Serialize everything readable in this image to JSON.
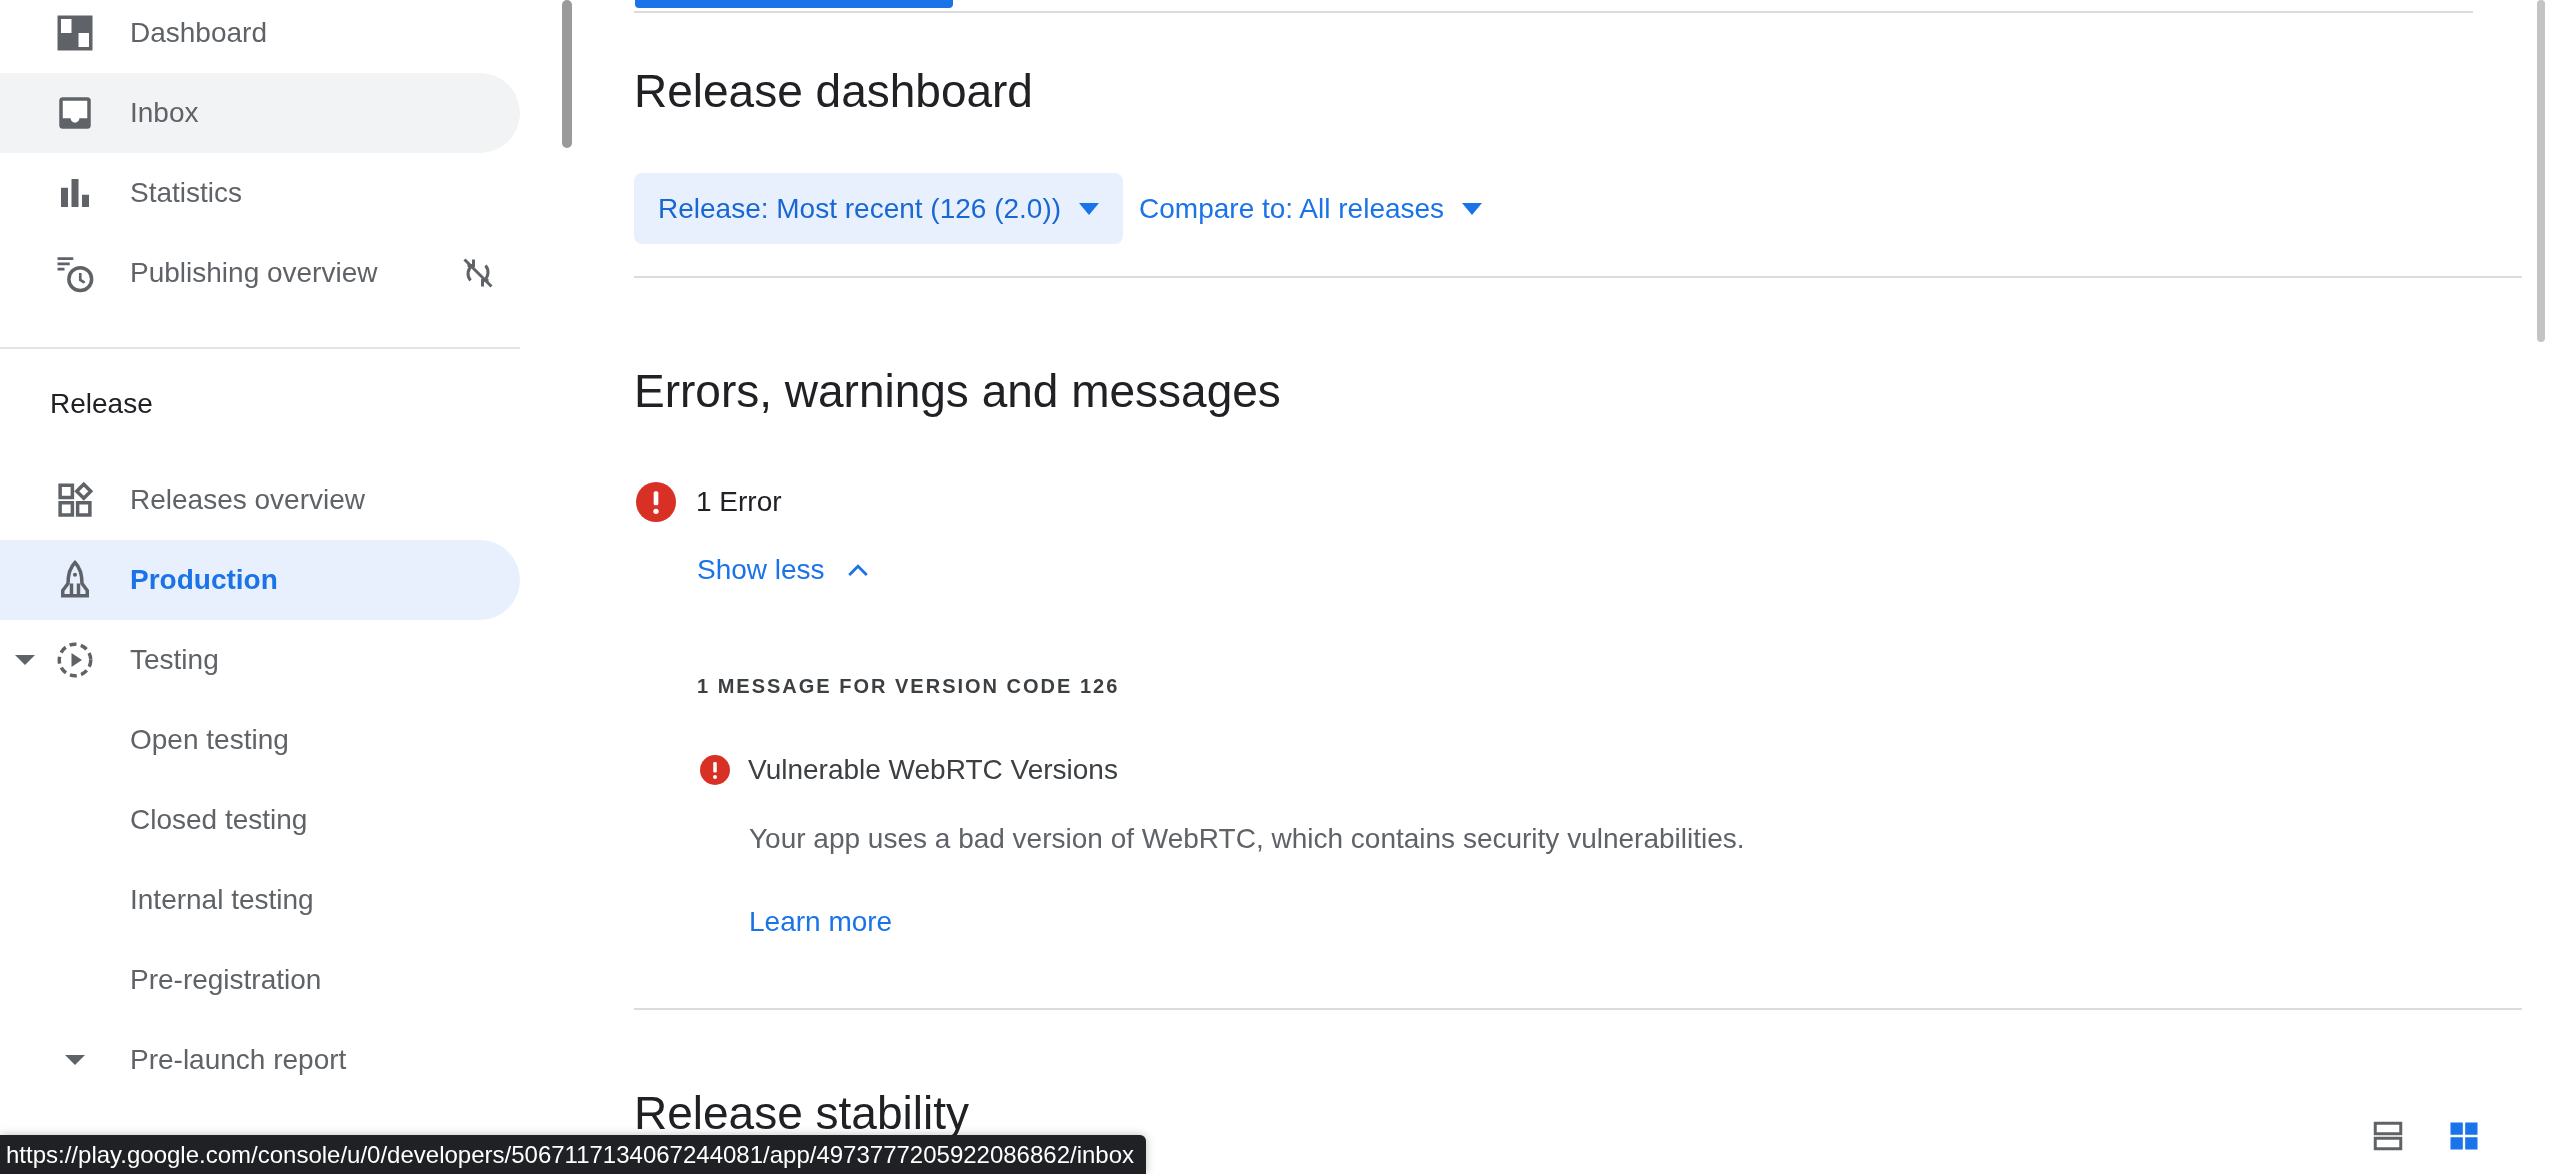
{
  "sidebar": {
    "top_items": [
      {
        "label": "Dashboard",
        "kind": "dashboard",
        "selected": false,
        "hovered": false,
        "sync_off": false
      },
      {
        "label": "Inbox",
        "kind": "inbox",
        "selected": false,
        "hovered": true,
        "sync_off": false
      },
      {
        "label": "Statistics",
        "kind": "statistics",
        "selected": false,
        "hovered": false,
        "sync_off": false
      },
      {
        "label": "Publishing overview",
        "kind": "publishing",
        "selected": false,
        "hovered": false,
        "sync_off": true
      }
    ],
    "section_title": "Release",
    "section_items": [
      {
        "label": "Releases overview",
        "kind": "releases",
        "selected": false
      },
      {
        "label": "Production",
        "kind": "production",
        "selected": true
      },
      {
        "label": "Testing",
        "kind": "testing",
        "selected": false,
        "expanded": true,
        "children": [
          {
            "label": "Open testing",
            "selected": false
          },
          {
            "label": "Closed testing",
            "selected": false
          },
          {
            "label": "Internal testing",
            "selected": false
          },
          {
            "label": "Pre-registration",
            "selected": false
          },
          {
            "label": "Pre-launch report",
            "selected": false,
            "expanded": true
          }
        ]
      }
    ]
  },
  "main": {
    "title": "Release dashboard",
    "filters": [
      {
        "label": "Release: Most recent (126 (2.0))",
        "selected": true
      },
      {
        "label": "Compare to: All releases",
        "selected": false
      }
    ],
    "errors_section": {
      "title": "Errors, warnings and messages",
      "summary": "1 Error",
      "toggle": "Show less",
      "expanded": true,
      "message_heading": "1 MESSAGE FOR VERSION CODE 126",
      "messages": [
        {
          "title": "Vulnerable WebRTC Versions",
          "description": "Your app uses a bad version of WebRTC, which contains security vulnerabilities.",
          "link": "Learn more"
        }
      ]
    },
    "stability_section": {
      "title": "Release stability",
      "view_options": [
        {
          "kind": "list",
          "selected": false
        },
        {
          "kind": "grid",
          "selected": true
        }
      ]
    }
  },
  "status_bar": {
    "url": "https://play.google.com/console/u/0/developers/5067117134067244081/app/4973777205922086862/inbox"
  }
}
